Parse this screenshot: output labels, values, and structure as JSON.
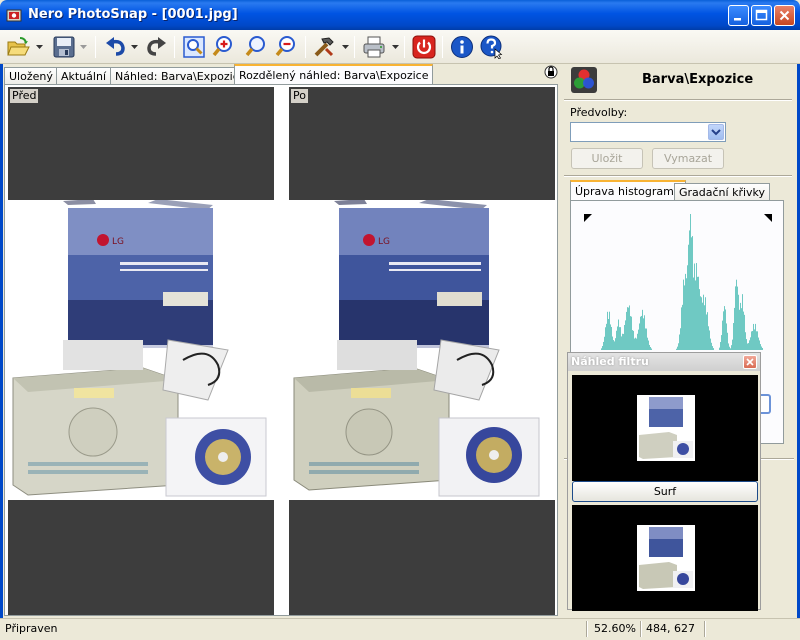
{
  "window": {
    "title": "Nero PhotoSnap - [0001.jpg]",
    "colors": {
      "titlebar": "#0054e3",
      "active_tab_accent": "#f8b334",
      "histogram": "#6fc9c3"
    }
  },
  "toolbar": {
    "buttons": [
      "open-icon",
      "save-icon",
      "undo-icon",
      "redo-icon",
      "fit-zoom-icon",
      "zoom-in-icon",
      "zoom-icon",
      "zoom-out-icon",
      "tools-icon",
      "print-icon",
      "exit-icon",
      "info-icon",
      "help-icon"
    ]
  },
  "tabs": [
    {
      "label": "Uložený"
    },
    {
      "label": "Aktuální"
    },
    {
      "label": "Náhled: Barva\\Expozice"
    },
    {
      "label": "Rozdělený náhled: Barva\\Expozice",
      "active": true
    }
  ],
  "preview": {
    "before_label": "Před",
    "after_label": "Po"
  },
  "panel": {
    "title": "Barva\\Expozice",
    "presets_label": "Předvolby:",
    "presets_value": "",
    "save_label": "Uložit",
    "delete_label": "Vymazat",
    "tabs": [
      {
        "label": "Úprava histogramu",
        "active": true
      },
      {
        "label": "Gradační křivky"
      }
    ]
  },
  "filter_preview": {
    "title": "Náhled filtru",
    "filter_button_label": "Surf"
  },
  "status": {
    "text": "Připraven",
    "zoom": "52.60%",
    "coords": "484, 627"
  }
}
